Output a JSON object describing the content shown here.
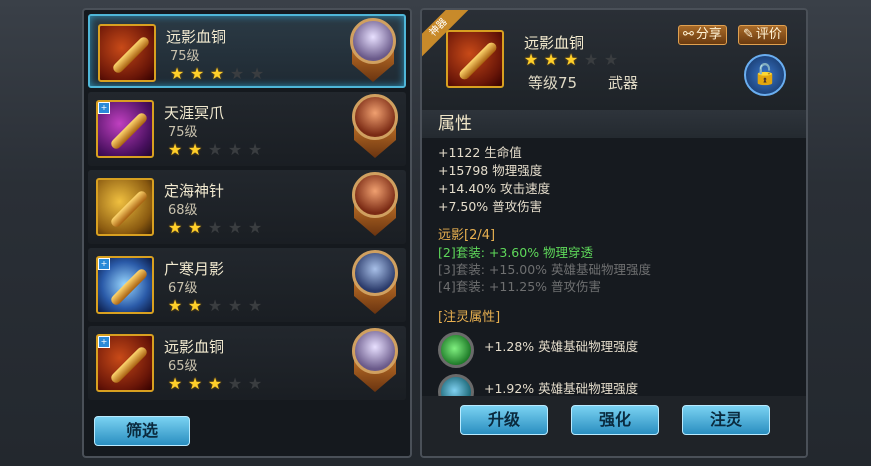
{
  "equipment_list": [
    {
      "name": "远影血铜",
      "level": "75级",
      "stars": 3,
      "thumb_style": "red",
      "badge": "",
      "hero_style": "purple",
      "selected": true
    },
    {
      "name": "天涯冥爪",
      "level": "75级",
      "stars": 2,
      "thumb_style": "purple",
      "badge": "+",
      "hero_style": "red",
      "selected": false
    },
    {
      "name": "定海神针",
      "level": "68级",
      "stars": 2,
      "thumb_style": "gold",
      "badge": "",
      "hero_style": "red",
      "selected": false
    },
    {
      "name": "广寒月影",
      "level": "67级",
      "stars": 2,
      "thumb_style": "ice",
      "badge": "+",
      "hero_style": "blue",
      "selected": false
    },
    {
      "name": "远影血铜",
      "level": "65级",
      "stars": 3,
      "thumb_style": "red",
      "badge": "+",
      "hero_style": "purple",
      "selected": false
    }
  ],
  "filter_button": "筛选",
  "detail": {
    "tag": "神器",
    "name": "远影血铜",
    "stars": 3,
    "level": "等级75",
    "type": "武器",
    "share_label": "分享",
    "rate_label": "评价",
    "attributes_title": "属性",
    "stats": [
      "+1122 生命值",
      "+15798 物理强度",
      "+14.40% 攻击速度",
      "+7.50% 普攻伤害"
    ],
    "set_title": "远影[2/4]",
    "set_bonuses": [
      {
        "text": "[2]套装: +3.60% 物理穿透",
        "active": true
      },
      {
        "text": "[3]套装: +15.00% 英雄基础物理强度",
        "active": false
      },
      {
        "text": "[4]套装: +11.25% 普攻伤害",
        "active": false
      }
    ],
    "spirit_title": "[注灵属性]",
    "spirit_stats": [
      "+1.28% 英雄基础物理强度",
      "+1.92% 英雄基础物理强度"
    ]
  },
  "actions": {
    "upgrade": "升级",
    "enhance": "强化",
    "infuse": "注灵"
  },
  "colors": {
    "accent_blue": "#4fb6d8",
    "gold": "#ffcf2a",
    "set_active": "#5ed85a"
  }
}
